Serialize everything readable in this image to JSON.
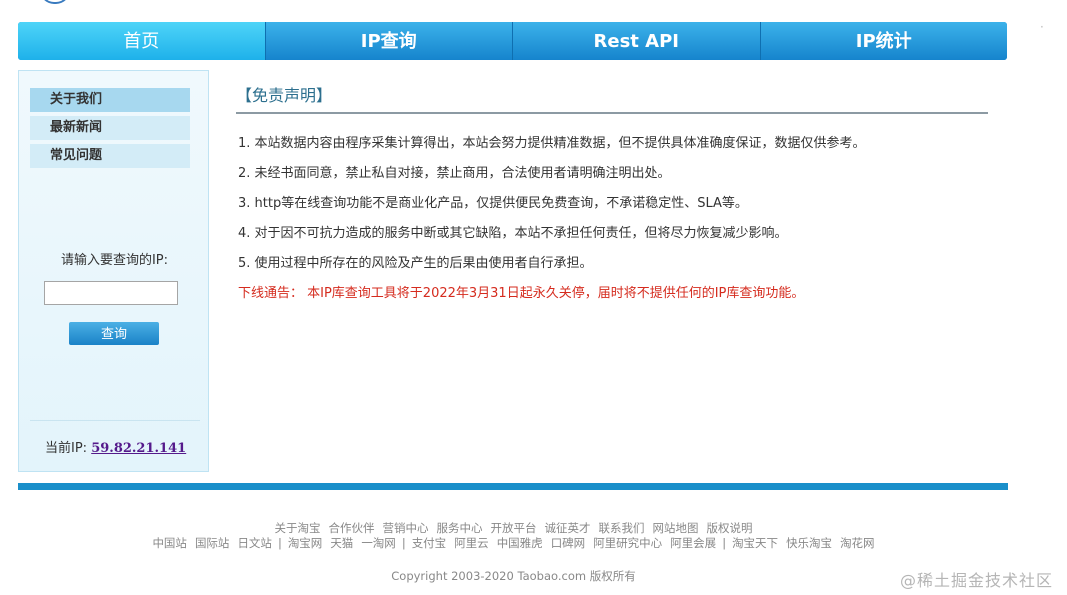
{
  "nav": {
    "items": [
      {
        "label": "首页",
        "active": true
      },
      {
        "label": "IP查询",
        "active": false
      },
      {
        "label": "Rest API",
        "active": false
      },
      {
        "label": "IP统计",
        "active": false
      }
    ]
  },
  "sidebar": {
    "links": [
      {
        "label": "关于我们",
        "active": true
      },
      {
        "label": "最新新闻",
        "active": false
      },
      {
        "label": "常见问题",
        "active": false
      }
    ],
    "ip_label": "请输入要查询的IP:",
    "ip_input_value": "",
    "query_button": "查询",
    "current_ip_label": "当前IP:",
    "current_ip_value": "59.82.21.141"
  },
  "content": {
    "title": "【免责声明】",
    "clauses": [
      "1. 本站数据内容由程序采集计算得出，本站会努力提供精准数据，但不提供具体准确度保证，数据仅供参考。",
      "2. 未经书面同意，禁止私自对接，禁止商用，合法使用者请明确注明出处。",
      "3. http等在线查询功能不是商业化产品，仅提供便民免费查询，不承诺稳定性、SLA等。",
      "4. 对于因不可抗力造成的服务中断或其它缺陷，本站不承担任何责任，但将尽力恢复减少影响。",
      "5. 使用过程中所存在的风险及产生的后果由使用者自行承担。"
    ],
    "notice": "下线通告：  本IP库查询工具将于2022年3月31日起永久关停，届时将不提供任何的IP库查询功能。"
  },
  "footer": {
    "links_row1": [
      "关于淘宝",
      "合作伙伴",
      "营销中心",
      "服务中心",
      "开放平台",
      "诚征英才",
      "联系我们",
      "网站地图",
      "版权说明"
    ],
    "links_row2": [
      "中国站",
      "国际站",
      "日文站",
      "|",
      "淘宝网",
      "天猫",
      "一淘网",
      "|",
      "支付宝",
      "阿里云",
      "中国雅虎",
      "口碑网",
      "阿里研究中心",
      "阿里会展",
      "|",
      "淘宝天下",
      "快乐淘宝",
      "淘花网"
    ],
    "copyright": "Copyright 2003-2020 Taobao.com 版权所有"
  },
  "watermark": "@稀土掘金技术社区",
  "colors": {
    "nav_blue": "#1684cd",
    "nav_active": "#1eb1ea",
    "notice_red": "#d52b1e",
    "title_teal": "#2c6f8e",
    "sidebar_bg": "#e3f4fb"
  }
}
